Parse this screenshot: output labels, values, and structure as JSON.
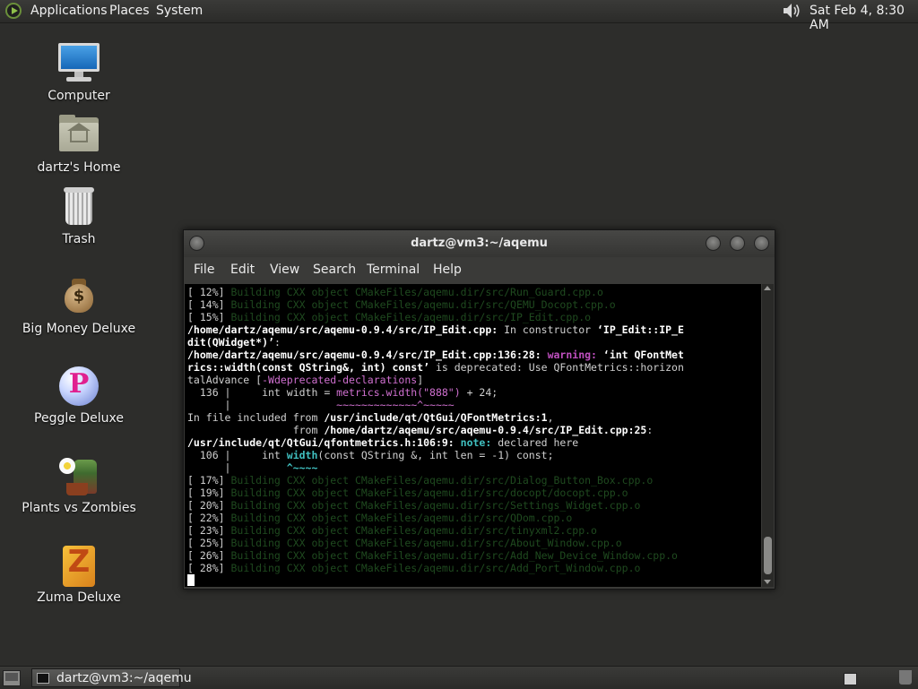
{
  "top_panel": {
    "menus": [
      "Applications",
      "Places",
      "System"
    ],
    "clock": "Sat Feb  4,  8:30 AM"
  },
  "desktop": {
    "icons": [
      {
        "label": "Computer",
        "icon": "computer-icon"
      },
      {
        "label": "dartz's Home",
        "icon": "home-folder-icon"
      },
      {
        "label": "Trash",
        "icon": "trash-icon"
      },
      {
        "label": "Big Money Deluxe",
        "icon": "money-bag-icon"
      },
      {
        "label": "Peggle Deluxe",
        "icon": "peggle-icon"
      },
      {
        "label": "Plants vs Zombies",
        "icon": "plants-vs-zombies-icon"
      },
      {
        "label": "Zuma Deluxe",
        "icon": "zuma-icon"
      }
    ]
  },
  "terminal": {
    "title": "dartz@vm3:~/aqemu",
    "menus": [
      "File",
      "Edit",
      "View",
      "Search",
      "Terminal",
      "Help"
    ],
    "lines": [
      [
        {
          "t": "[ 12%] ",
          "c": "pct"
        },
        {
          "t": "Building CXX object CMakeFiles/aqemu.dir/src/Run_Guard.cpp.o",
          "c": "build"
        }
      ],
      [
        {
          "t": "[ 14%] ",
          "c": "pct"
        },
        {
          "t": "Building CXX object CMakeFiles/aqemu.dir/src/QEMU_Docopt.cpp.o",
          "c": "build"
        }
      ],
      [
        {
          "t": "[ 15%] ",
          "c": "pct"
        },
        {
          "t": "Building CXX object CMakeFiles/aqemu.dir/src/IP_Edit.cpp.o",
          "c": "build"
        }
      ],
      [
        {
          "t": "/home/dartz/aqemu/src/aqemu-0.9.4/src/IP_Edit.cpp:",
          "c": "b"
        },
        {
          "t": " In constructor ",
          "c": ""
        },
        {
          "t": "‘IP_Edit::IP_E",
          "c": "b"
        }
      ],
      [
        {
          "t": "dit(QWidget*)’",
          "c": "b"
        },
        {
          "t": ":",
          "c": ""
        }
      ],
      [
        {
          "t": "/home/dartz/aqemu/src/aqemu-0.9.4/src/IP_Edit.cpp:136:28:",
          "c": "b"
        },
        {
          "t": " warning:",
          "c": "warn"
        },
        {
          "t": " ‘int QFontMet",
          "c": "b"
        }
      ],
      [
        {
          "t": "rics::width(const QString&, int) const’",
          "c": "b"
        },
        {
          "t": " is deprecated: Use QFontMetrics::horizon",
          "c": ""
        }
      ],
      [
        {
          "t": "talAdvance [",
          "c": ""
        },
        {
          "t": "-Wdeprecated-declarations",
          "c": "pinkc"
        },
        {
          "t": "]",
          "c": ""
        }
      ],
      [
        {
          "t": "  136 |     int width = ",
          "c": ""
        },
        {
          "t": "metrics.width(\"888\")",
          "c": "pinkc"
        },
        {
          "t": " + 24;",
          "c": ""
        }
      ],
      [
        {
          "t": "      |                 ",
          "c": ""
        },
        {
          "t": "~~~~~~~~~~~~~^~~~~~",
          "c": "pinkc"
        }
      ],
      [
        {
          "t": "In file included from ",
          "c": ""
        },
        {
          "t": "/usr/include/qt/QtGui/QFontMetrics:1",
          "c": "b"
        },
        {
          "t": ",",
          "c": ""
        }
      ],
      [
        {
          "t": "                 from ",
          "c": ""
        },
        {
          "t": "/home/dartz/aqemu/src/aqemu-0.9.4/src/IP_Edit.cpp:25",
          "c": "b"
        },
        {
          "t": ":",
          "c": ""
        }
      ],
      [
        {
          "t": "/usr/include/qt/QtGui/qfontmetrics.h:106:9:",
          "c": "b"
        },
        {
          "t": " note:",
          "c": "note"
        },
        {
          "t": " declared here",
          "c": ""
        }
      ],
      [
        {
          "t": "  106 |     int ",
          "c": ""
        },
        {
          "t": "width",
          "c": "note"
        },
        {
          "t": "(const QString &, int len = -1) const;",
          "c": ""
        }
      ],
      [
        {
          "t": "      |         ",
          "c": ""
        },
        {
          "t": "^~~~~",
          "c": "note"
        }
      ],
      [
        {
          "t": "[ 17%] ",
          "c": "pct"
        },
        {
          "t": "Building CXX object CMakeFiles/aqemu.dir/src/Dialog_Button_Box.cpp.o",
          "c": "build"
        }
      ],
      [
        {
          "t": "[ 19%] ",
          "c": "pct"
        },
        {
          "t": "Building CXX object CMakeFiles/aqemu.dir/src/docopt/docopt.cpp.o",
          "c": "build"
        }
      ],
      [
        {
          "t": "[ 20%] ",
          "c": "pct"
        },
        {
          "t": "Building CXX object CMakeFiles/aqemu.dir/src/Settings_Widget.cpp.o",
          "c": "build"
        }
      ],
      [
        {
          "t": "[ 22%] ",
          "c": "pct"
        },
        {
          "t": "Building CXX object CMakeFiles/aqemu.dir/src/QDom.cpp.o",
          "c": "build"
        }
      ],
      [
        {
          "t": "[ 23%] ",
          "c": "pct"
        },
        {
          "t": "Building CXX object CMakeFiles/aqemu.dir/src/tinyxml2.cpp.o",
          "c": "build"
        }
      ],
      [
        {
          "t": "[ 25%] ",
          "c": "pct"
        },
        {
          "t": "Building CXX object CMakeFiles/aqemu.dir/src/About_Window.cpp.o",
          "c": "build"
        }
      ],
      [
        {
          "t": "[ 26%] ",
          "c": "pct"
        },
        {
          "t": "Building CXX object CMakeFiles/aqemu.dir/src/Add_New_Device_Window.cpp.o",
          "c": "build"
        }
      ],
      [
        {
          "t": "[ 28%] ",
          "c": "pct"
        },
        {
          "t": "Building CXX object CMakeFiles/aqemu.dir/src/Add_Port_Window.cpp.o",
          "c": "build"
        }
      ]
    ]
  },
  "bottom_panel": {
    "task_label": "dartz@vm3:~/aqemu"
  },
  "colors": {
    "desktop_bg": "#2d2d2b",
    "terminal_bg": "#000000",
    "build_text": "#1f4a1f",
    "warning": "#c050c0",
    "note": "#40c0c0"
  }
}
